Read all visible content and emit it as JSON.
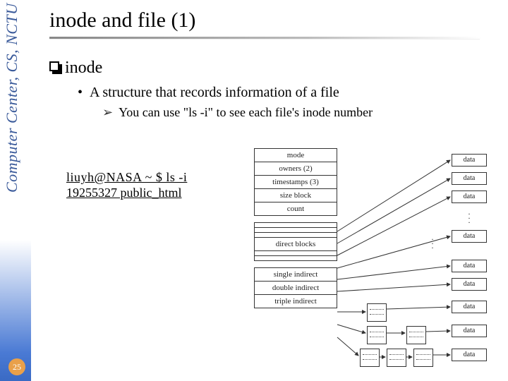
{
  "sidebar": {
    "org": "Computer Center, CS, NCTU"
  },
  "page_number": "25",
  "title": "inode and file (1)",
  "bullets": {
    "l1": "inode",
    "l2": "A structure that records information of a file",
    "l3": "You can use \"ls -i\" to see each file's inode number"
  },
  "terminal": {
    "line1": "liuyh@NASA ~ $ ls -i",
    "line2": "19255327 public_html"
  },
  "diagram": {
    "cells": {
      "mode": "mode",
      "owners": "owners (2)",
      "timestamps": "timestamps (3)",
      "size": "size block",
      "count": "count",
      "blank1": "",
      "blank2": "",
      "blank3": "",
      "direct": "direct blocks",
      "blank4": "",
      "blank5": "",
      "single": "single indirect",
      "double": "double indirect",
      "triple": "triple indirect"
    },
    "data_label": "data"
  }
}
